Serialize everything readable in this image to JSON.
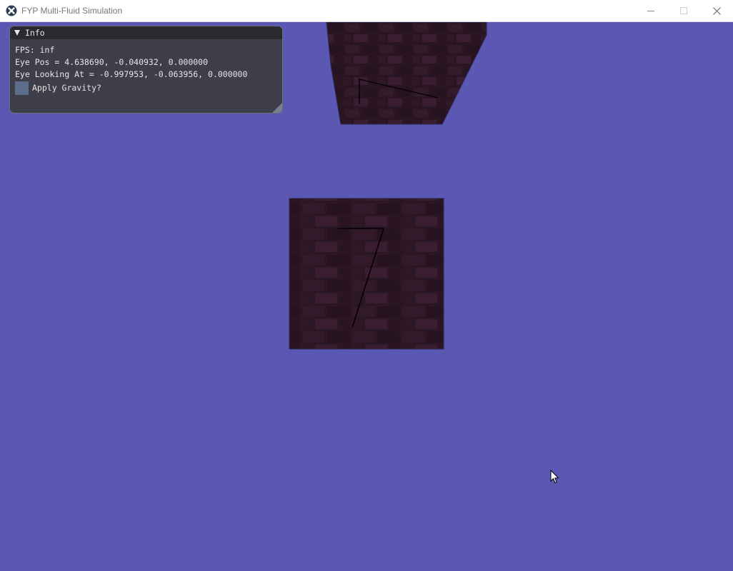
{
  "window": {
    "title": "FYP Multi-Fluid Simulation",
    "controls": [
      "minimize",
      "maximize",
      "close"
    ]
  },
  "scene": {
    "background_color": "#5a58b2",
    "brick_color": "#2b1624",
    "mortar_color": "#2f2c52"
  },
  "info_panel": {
    "title": "Info",
    "fps_line": "FPS: inf",
    "eye_pos_line": "Eye Pos = 4.638690, -0.040932, 0.000000",
    "eye_look_line": "Eye Looking At = -0.997953, -0.063956, 0.000000",
    "checkbox": {
      "label": "Apply Gravity?",
      "checked": false
    }
  },
  "icons": {
    "app": "app-logo-icon",
    "collapse": "collapse-arrow-icon",
    "cursor": "mouse-cursor-icon"
  }
}
